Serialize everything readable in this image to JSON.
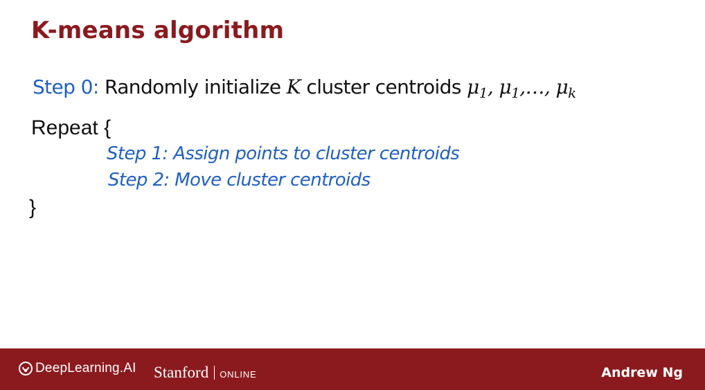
{
  "slide": {
    "title": "K-means algorithm",
    "step0": {
      "label": "Step 0:",
      "text_before": " Randomly initialize ",
      "var_k": "K",
      "text_after": " cluster centroids ",
      "mu": "μ",
      "sub1": "1",
      "sep1": ", ",
      "sub2": "1",
      "ellipsis": ",…, ",
      "subk": "k"
    },
    "repeat_open": "Repeat {",
    "step1": "Step 1: Assign points to cluster centroids",
    "step2": "Step 2: Move cluster centroids",
    "repeat_close": "}"
  },
  "footer": {
    "deeplearning_logo_text": "DeepLearning.AI",
    "stanford_word": "Stanford",
    "stanford_online": "ONLINE",
    "author": "Andrew Ng",
    "background_color": "#8b1a1e"
  }
}
